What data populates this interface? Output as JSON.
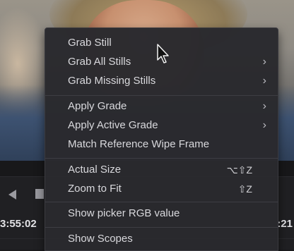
{
  "viewer": {
    "timecode_left": "3:55:02",
    "timecode_right": ":21"
  },
  "menu": {
    "items": [
      {
        "label": "Grab Still",
        "submenu": false,
        "shortcut": ""
      },
      {
        "label": "Grab All Stills",
        "submenu": true,
        "shortcut": ""
      },
      {
        "label": "Grab Missing Stills",
        "submenu": true,
        "shortcut": ""
      },
      {
        "label": "Apply Grade",
        "submenu": true,
        "shortcut": ""
      },
      {
        "label": "Apply Active Grade",
        "submenu": true,
        "shortcut": ""
      },
      {
        "label": "Match Reference Wipe Frame",
        "submenu": false,
        "shortcut": ""
      },
      {
        "label": "Actual Size",
        "submenu": false,
        "shortcut": "⌥⇧Z"
      },
      {
        "label": "Zoom to Fit",
        "submenu": false,
        "shortcut": "⇧Z"
      },
      {
        "label": "Show picker RGB value",
        "submenu": false,
        "shortcut": ""
      },
      {
        "label": "Show Scopes",
        "submenu": false,
        "shortcut": ""
      }
    ],
    "chevron": "›"
  }
}
